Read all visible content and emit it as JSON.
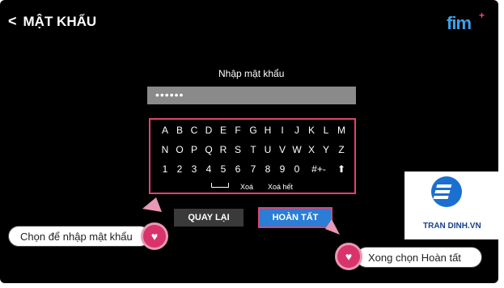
{
  "header": {
    "back_glyph": "<",
    "title": "MẬT KHẨU",
    "logo_text": "fim",
    "logo_plus": "+"
  },
  "form": {
    "prompt": "Nhập mật khẩu",
    "password_value": "••••••"
  },
  "keyboard": {
    "row1": [
      "A",
      "B",
      "C",
      "D",
      "E",
      "F",
      "G",
      "H",
      "I",
      "J",
      "K",
      "L",
      "M"
    ],
    "row2": [
      "N",
      "O",
      "P",
      "Q",
      "R",
      "S",
      "T",
      "U",
      "V",
      "W",
      "X",
      "Y",
      "Z"
    ],
    "row3": [
      "1",
      "2",
      "3",
      "4",
      "5",
      "6",
      "7",
      "8",
      "9",
      "0",
      "#+-",
      "⬆"
    ],
    "delete": "Xoá",
    "delete_all": "Xoá hết"
  },
  "buttons": {
    "back_label": "QUAY LẠI",
    "done_label": "HOÀN TẤT"
  },
  "annotations": {
    "left": "Chọn để nhập mật khẩu",
    "right": "Xong chọn Hoàn tất"
  },
  "brand": {
    "text": "TRAN DINH.VN"
  },
  "colors": {
    "highlight": "#e0436f",
    "primary_button": "#2a7ed6",
    "background": "#000000"
  }
}
